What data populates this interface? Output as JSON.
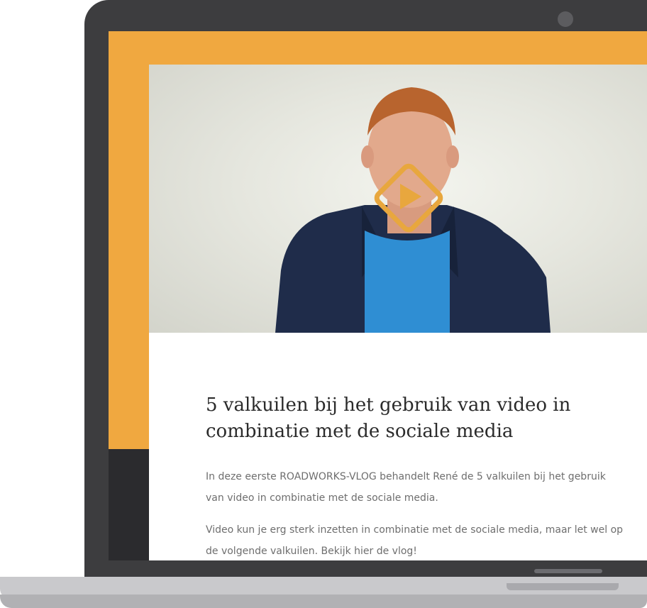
{
  "article": {
    "title": "5 valkuilen bij het gebruik van video in combinatie met de sociale media",
    "paragraphs": [
      "In deze eerste ROADWORKS-VLOG behandelt René de 5 valkuilen bij het gebruik van video in combinatie met de sociale media.",
      "Video kun je erg sterk inzetten in combinatie met de sociale media, maar let wel op de volgende valkuilen. Bekijk hier de vlog!"
    ]
  },
  "video": {
    "play_icon": "play-diamond-icon",
    "accent_color": "#f0a840"
  },
  "colors": {
    "brand_orange": "#f0a840",
    "dark_band": "#2b2b2e",
    "laptop_bezel": "#3d3d3f"
  }
}
